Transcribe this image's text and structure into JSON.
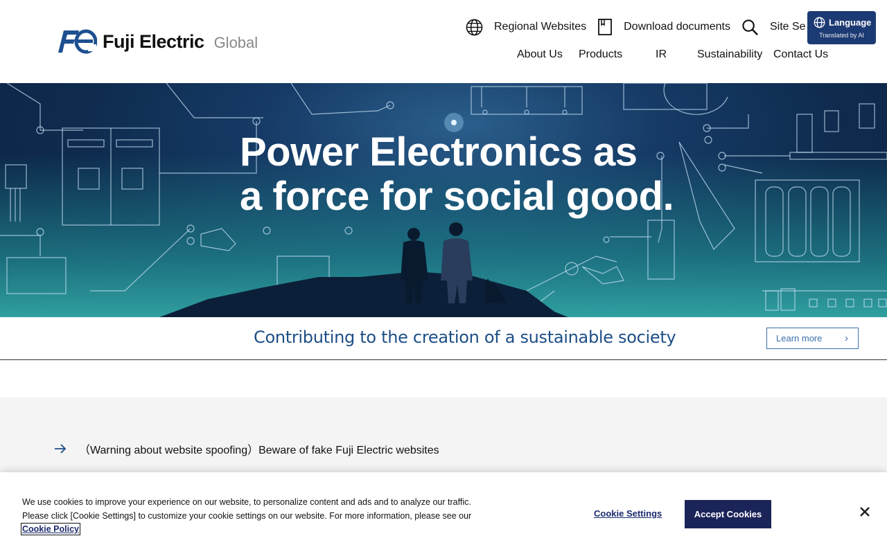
{
  "header": {
    "logo_text": "Fuji Electric",
    "logo_sub": "Global",
    "utility": [
      {
        "label": "Regional Websites",
        "icon": "globe-icon"
      },
      {
        "label": "Download documents",
        "icon": "document-icon"
      },
      {
        "label": "Site Se",
        "icon": "search-icon"
      }
    ],
    "language": {
      "label": "Language",
      "sub": "Translated by AI",
      "icon": "globe-icon"
    },
    "nav": [
      "About Us",
      "Products",
      "IR",
      "Sustainability",
      "Contact Us"
    ]
  },
  "hero": {
    "title_line1": "Power Electronics as",
    "title_line2": "a force for social good."
  },
  "strip": {
    "text": "Contributing to the creation of a sustainable society",
    "button": "Learn more"
  },
  "notice": {
    "text": "（Warning about website spoofing）Beware of fake Fuji Electric websites",
    "icon": "arrow-right-icon"
  },
  "cookie": {
    "text": "We use cookies to improve your experience on our website, to personalize content and ads and to analyze our traffic. Please click [Cookie Settings] to customize your cookie settings on our website. For more information, please see our",
    "policy_link": "Cookie Policy",
    "settings_label": "Cookie Settings",
    "accept_label": "Accept Cookies",
    "close_icon": "close-icon"
  },
  "colors": {
    "brand_blue": "#1c3a73",
    "strip_text": "#1d4e86",
    "accept_bg": "#1b2459"
  }
}
